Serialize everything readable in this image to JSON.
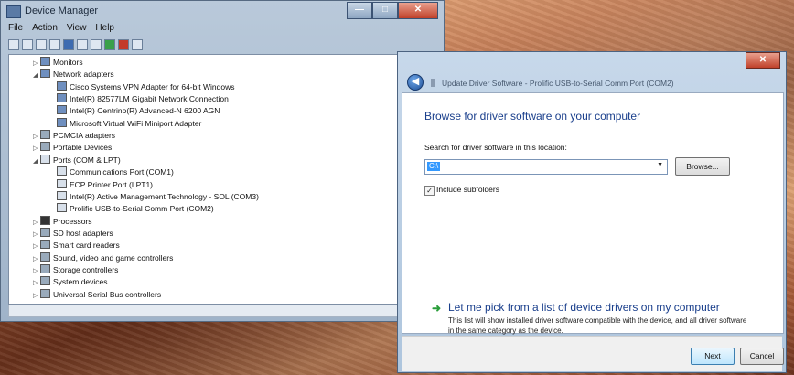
{
  "device_manager": {
    "title": "Device Manager",
    "menu": [
      "File",
      "Action",
      "View",
      "Help"
    ],
    "tree": [
      {
        "label": "Monitors",
        "level": 0,
        "expander": "▷",
        "icon": "monitor-icon"
      },
      {
        "label": "Network adapters",
        "level": 0,
        "expander": "◢",
        "icon": "network-icon"
      },
      {
        "label": "Cisco Systems VPN Adapter for 64-bit Windows",
        "level": 1,
        "icon": "network-icon"
      },
      {
        "label": "Intel(R) 82577LM Gigabit Network Connection",
        "level": 1,
        "icon": "network-icon"
      },
      {
        "label": "Intel(R) Centrino(R) Advanced-N 6200 AGN",
        "level": 1,
        "icon": "network-icon"
      },
      {
        "label": "Microsoft Virtual WiFi Miniport Adapter",
        "level": 1,
        "icon": "network-icon"
      },
      {
        "label": "PCMCIA adapters",
        "level": 0,
        "expander": "▷",
        "icon": "card-icon"
      },
      {
        "label": "Portable Devices",
        "level": 0,
        "expander": "▷",
        "icon": "card-icon"
      },
      {
        "label": "Ports (COM & LPT)",
        "level": 0,
        "expander": "◢",
        "icon": "port-icon"
      },
      {
        "label": "Communications Port (COM1)",
        "level": 1,
        "icon": "port-icon"
      },
      {
        "label": "ECP Printer Port (LPT1)",
        "level": 1,
        "icon": "port-icon"
      },
      {
        "label": "Intel(R) Active Management Technology - SOL (COM3)",
        "level": 1,
        "icon": "port-icon"
      },
      {
        "label": "Prolific USB-to-Serial Comm Port (COM2)",
        "level": 1,
        "icon": "port-icon"
      },
      {
        "label": "Processors",
        "level": 0,
        "expander": "▷",
        "icon": "chip-icon"
      },
      {
        "label": "SD host adapters",
        "level": 0,
        "expander": "▷",
        "icon": "card-icon"
      },
      {
        "label": "Smart card readers",
        "level": 0,
        "expander": "▷",
        "icon": "card-icon"
      },
      {
        "label": "Sound, video and game controllers",
        "level": 0,
        "expander": "▷",
        "icon": "card-icon"
      },
      {
        "label": "Storage controllers",
        "level": 0,
        "expander": "▷",
        "icon": "card-icon"
      },
      {
        "label": "System devices",
        "level": 0,
        "expander": "▷",
        "icon": "card-icon"
      },
      {
        "label": "Universal Serial Bus controllers",
        "level": 0,
        "expander": "▷",
        "icon": "card-icon"
      }
    ]
  },
  "update_driver": {
    "nav_title": "Update Driver Software - Prolific USB-to-Serial Comm Port (COM2)",
    "heading": "Browse for driver software on your computer",
    "search_label": "Search for driver software in this location:",
    "path_value": "C:\\",
    "browse_label": "Browse...",
    "include_subfolders_label": "Include subfolders",
    "include_subfolders_checked": true,
    "pick_link": "Let me pick from a list of device drivers on my computer",
    "pick_desc": "This list will show installed driver software compatible with the device, and all driver software in the same category as the device.",
    "next_label": "Next",
    "cancel_label": "Cancel"
  }
}
